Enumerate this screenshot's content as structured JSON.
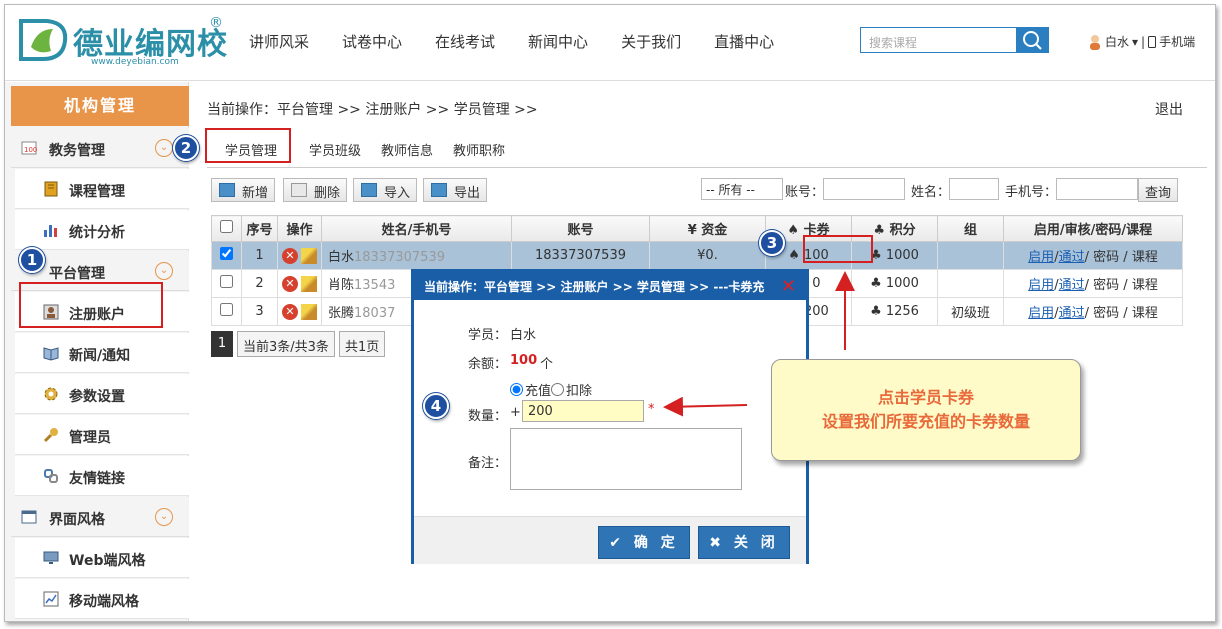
{
  "header": {
    "logo_text": "德业编网校",
    "logo_reg": "®",
    "logo_url": "www.deyebian.com",
    "nav": [
      "讲师风采",
      "试卷中心",
      "在线考试",
      "新闻中心",
      "关于我们",
      "直播中心"
    ],
    "search_placeholder": "搜索课程",
    "user_name": "白水",
    "user_caret": "▾",
    "user_sep": "|",
    "mobile_label": "手机端"
  },
  "sidebar": {
    "title": "机构管理",
    "groups": [
      {
        "label": "教务管理",
        "items": [
          "课程管理",
          "统计分析"
        ]
      },
      {
        "label": "平台管理",
        "items": [
          "注册账户",
          "新闻/通知",
          "参数设置",
          "管理员",
          "友情链接"
        ]
      },
      {
        "label": "界面风格",
        "items": [
          "Web端风格",
          "移动端风格"
        ]
      }
    ],
    "chevron": "⌄"
  },
  "main": {
    "breadcrumb": "当前操作：平台管理 >> 注册账户 >> 学员管理 >>",
    "logout": "退出",
    "tabs": [
      "学员管理",
      "学员班级",
      "教师信息",
      "教师职称"
    ],
    "toolbar": [
      "新增",
      "删除",
      "导入",
      "导出"
    ],
    "filter": {
      "select_value": "-- 所有 --",
      "account_label": "账号：",
      "name_label": "姓名：",
      "phone_label": "手机号：",
      "query_button": "查询"
    },
    "table": {
      "headers": [
        "序号",
        "操作",
        "姓名/手机号",
        "账号",
        "¥ 资金",
        "♠ 卡券",
        "♣ 积分",
        "组",
        "启用/审核/密码/课程"
      ],
      "rows": [
        {
          "no": "1",
          "name": "白水",
          "phone": "18337307539",
          "account": "18337307539",
          "fund": "¥0.",
          "card": "♠ 100",
          "points": "♣ 1000",
          "group": ""
        },
        {
          "no": "2",
          "name": "肖陈",
          "phone": "13543",
          "account": "",
          "fund": "",
          "card": "♠ 0",
          "points": "♣ 1000",
          "group": ""
        },
        {
          "no": "3",
          "name": "张腾",
          "phone": "18037",
          "account": "",
          "fund": "",
          "card": "♠ 200",
          "points": "♣ 1256",
          "group": "初级班"
        }
      ],
      "actions": {
        "enable": "启用",
        "sep": "/",
        "audit": "通过",
        "pwd": "密码",
        "course": "课程"
      }
    },
    "pager": {
      "current": "1",
      "info": "当前3条/共3条",
      "total": "共1页"
    }
  },
  "modal": {
    "title": "当前操作：平台管理 >> 注册账户 >> 学员管理 >> ---卡券充",
    "close": "✕",
    "student_label": "学员：",
    "student_value": "白水",
    "balance_label": "余额：",
    "balance_value": "100",
    "balance_unit": "个",
    "option_recharge": "充值",
    "option_deduct": "扣除",
    "qty_label": "数量：",
    "qty_sign": "+",
    "qty_value": "200",
    "required_mark": "*",
    "note_label": "备注：",
    "confirm": "确 定",
    "cancel": "关 闭"
  },
  "callout": {
    "line1": "点击学员卡券",
    "line2": "设置我们所要充值的卡券数量"
  },
  "badges": [
    "1",
    "2",
    "3",
    "4"
  ],
  "colors": {
    "brand": "#2b8fa8",
    "accent": "#e8954a",
    "primary": "#1a5ea8",
    "highlight": "#d42020"
  }
}
